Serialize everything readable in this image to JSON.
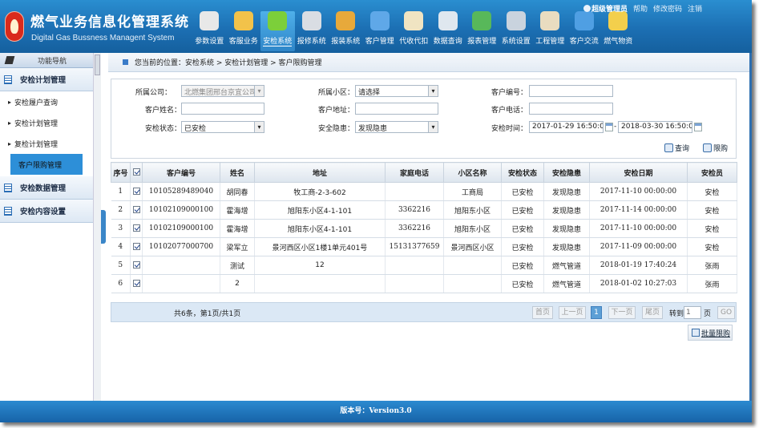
{
  "app": {
    "title_cn": "燃气业务信息化管理系统",
    "title_en": "Digital Gas Bussness Managent System"
  },
  "user": {
    "name": "超级管理员",
    "links": [
      "帮助",
      "修改密码",
      "注销"
    ]
  },
  "topnav": [
    {
      "label": "参数设置",
      "icon": "gear-icon",
      "color": "#e8e8e8"
    },
    {
      "label": "客服业务",
      "icon": "service-agent-icon",
      "color": "#f2c24a"
    },
    {
      "label": "安检系统",
      "icon": "shield-check-icon",
      "color": "#7ccf3a",
      "active": true
    },
    {
      "label": "报修系统",
      "icon": "tools-icon",
      "color": "#d9dde3"
    },
    {
      "label": "报装系统",
      "icon": "install-kit-icon",
      "color": "#e7a93b"
    },
    {
      "label": "客户管理",
      "icon": "users-icon",
      "color": "#5fa8e8"
    },
    {
      "label": "代收代扣",
      "icon": "book-icon",
      "color": "#f0e4c2"
    },
    {
      "label": "数据查询",
      "icon": "magnifier-icon",
      "color": "#dfe7ef"
    },
    {
      "label": "报表管理",
      "icon": "bar-chart-icon",
      "color": "#58b85a"
    },
    {
      "label": "系统设置",
      "icon": "settings-panel-icon",
      "color": "#c9d3de"
    },
    {
      "label": "工程管理",
      "icon": "engineering-book-icon",
      "color": "#e9dcc0"
    },
    {
      "label": "客户交流",
      "icon": "chat-users-icon",
      "color": "#4f9fe3"
    },
    {
      "label": "燃气物资",
      "icon": "warehouse-icon",
      "color": "#f3cf4c"
    }
  ],
  "sidebar": {
    "title": "功能导航",
    "groups": [
      {
        "label": "安检计划管理",
        "items": [
          "安检履户查询",
          "安检计划管理",
          "复检计划管理",
          "客户限购管理"
        ],
        "selected": 3
      },
      {
        "label": "安检数据管理",
        "items": []
      },
      {
        "label": "安检内容设置",
        "items": []
      }
    ]
  },
  "breadcrumb": "您当前的位置：安检系统 > 安检计划管理 > 客户限购管理",
  "search": {
    "company_label": "所属公司：",
    "company_value": "北燃集团邢台京宜公司",
    "community_label": "所属小区：",
    "community_value": "请选择",
    "cust_no_label": "客户编号：",
    "cust_no_value": "",
    "cust_name_label": "客户姓名：",
    "cust_name_value": "",
    "address_label": "客户地址：",
    "address_value": "",
    "phone_label": "客户电话：",
    "phone_value": "",
    "status_label": "安检状态：",
    "status_value": "已安检",
    "hazard_label": "安全隐患：",
    "hazard_value": "发现隐患",
    "time_label": "安检时间：",
    "time_from": "2017-01-29 16:50:00",
    "time_sep": "-",
    "time_to": "2018-03-30 16:50:00",
    "query_btn": "查询",
    "limit_btn": "限购"
  },
  "table": {
    "headers": [
      "序号",
      "",
      "客户编号",
      "姓名",
      "地址",
      "家庭电话",
      "小区名称",
      "安检状态",
      "安检隐患",
      "安检日期",
      "安检员"
    ],
    "rows": [
      [
        "1",
        "",
        "10105289489040",
        "胡同春",
        "牧工商-2-3-602",
        "",
        "工商局",
        "已安检",
        "发现隐患",
        "2017-11-10 00:00:00",
        "安检"
      ],
      [
        "2",
        "",
        "10102109000100",
        "霍海增",
        "旭阳东小区4-1-101",
        "3362216",
        "旭阳东小区",
        "已安检",
        "发现隐患",
        "2017-11-14 00:00:00",
        "安检"
      ],
      [
        "3",
        "",
        "10102109000100",
        "霍海增",
        "旭阳东小区4-1-101",
        "3362216",
        "旭阳东小区",
        "已安检",
        "发现隐患",
        "2017-11-10 00:00:00",
        "安检"
      ],
      [
        "4",
        "",
        "10102077000700",
        "梁军立",
        "景河西区小区1楼1单元401号",
        "15131377659",
        "景河西区小区",
        "已安检",
        "发现隐患",
        "2017-11-09 00:00:00",
        "安检"
      ],
      [
        "5",
        "",
        "",
        "测试",
        "12",
        "",
        "",
        "已安检",
        "燃气管道",
        "2018-01-19 17:40:24",
        "张雨"
      ],
      [
        "6",
        "",
        "",
        "2",
        "",
        "",
        "",
        "已安检",
        "燃气管道",
        "2018-01-02 10:27:03",
        "张雨"
      ]
    ]
  },
  "pager": {
    "info": "共6条，第1页/共1页",
    "first": "首页",
    "prev": "上一页",
    "current": "1",
    "next": "下一页",
    "last": "尾页",
    "goto_label": "转到",
    "goto_value": "1",
    "page_unit": "页",
    "go": "GO"
  },
  "bulk_btn": "批量限购",
  "footer": "版本号：Version3.0"
}
